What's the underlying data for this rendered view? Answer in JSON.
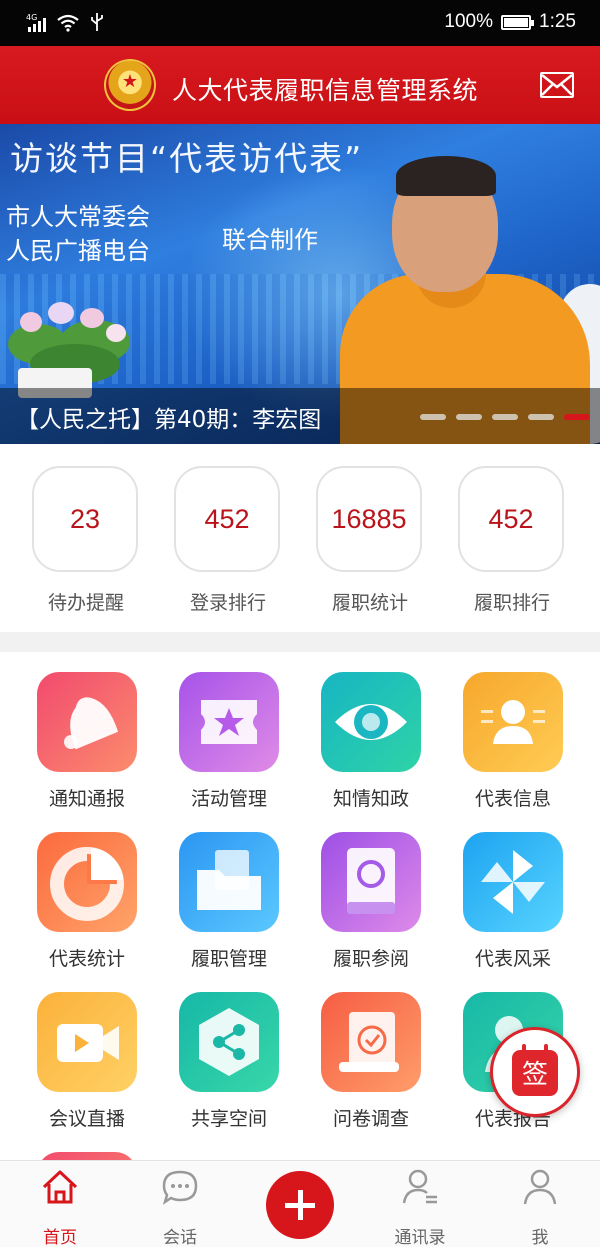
{
  "status_bar": {
    "network": "4G",
    "battery_percent_text": "100%",
    "battery_level": 1.0,
    "time": "1:25"
  },
  "header": {
    "title": "人大代表履职信息管理系统",
    "emblem_icon": "national-emblem-icon",
    "mail_icon": "mail-icon"
  },
  "banner": {
    "headline": "访谈节目“代表访代表”",
    "org_line_1": "市人大常委会",
    "org_line_2": "人民广播电台",
    "coproduce": "联合制作",
    "caption": "【人民之托】第40期：李宏图",
    "slide_count": 5,
    "active_slide": 5,
    "active_dot_color": "#d7161c"
  },
  "stats": [
    {
      "value": "23",
      "label": "待办提醒"
    },
    {
      "value": "452",
      "label": "登录排行"
    },
    {
      "value": "16885",
      "label": "履职统计"
    },
    {
      "value": "452",
      "label": "履职排行"
    }
  ],
  "menu": [
    {
      "label": "通知通报",
      "icon": "bell-icon",
      "colors": [
        "#f24a6e",
        "#fb8c6d"
      ]
    },
    {
      "label": "活动管理",
      "icon": "ticket-star-icon",
      "colors": [
        "#a653ea",
        "#e08be6"
      ]
    },
    {
      "label": "知情知政",
      "icon": "eye-icon",
      "colors": [
        "#17b5c4",
        "#2ed3a6"
      ]
    },
    {
      "label": "代表信息",
      "icon": "id-card-icon",
      "colors": [
        "#f7a72c",
        "#ffcc54"
      ]
    },
    {
      "label": "代表统计",
      "icon": "pie-chart-icon",
      "colors": [
        "#fb6a3d",
        "#ffa36a"
      ]
    },
    {
      "label": "履职管理",
      "icon": "folder-icon",
      "colors": [
        "#2b96f2",
        "#5bc8ff"
      ]
    },
    {
      "label": "履职参阅",
      "icon": "book-icon",
      "colors": [
        "#9d4fe6",
        "#de8ae9"
      ]
    },
    {
      "label": "代表风采",
      "icon": "pinwheel-icon",
      "colors": [
        "#1da3f0",
        "#57d4ff"
      ]
    },
    {
      "label": "会议直播",
      "icon": "video-icon",
      "colors": [
        "#fbb13a",
        "#ffd165"
      ]
    },
    {
      "label": "共享空间",
      "icon": "share-icon",
      "colors": [
        "#16b7a7",
        "#38d7a9"
      ]
    },
    {
      "label": "问卷调查",
      "icon": "survey-icon",
      "colors": [
        "#f65d43",
        "#ff9d6a"
      ]
    },
    {
      "label": "代表报告",
      "icon": "report-icon",
      "colors": [
        "#17b8a7",
        "#37d4a8"
      ]
    }
  ],
  "sign_button": {
    "label": "签",
    "icon": "calendar-sign-icon"
  },
  "bottom_nav": [
    {
      "label": "首页",
      "icon": "home-icon",
      "active": true
    },
    {
      "label": "会话",
      "icon": "chat-icon",
      "active": false
    },
    {
      "label": "",
      "icon": "plus-icon",
      "active": false
    },
    {
      "label": "通讯录",
      "icon": "contacts-icon",
      "active": false
    },
    {
      "label": "我",
      "icon": "user-icon",
      "active": false
    }
  ]
}
